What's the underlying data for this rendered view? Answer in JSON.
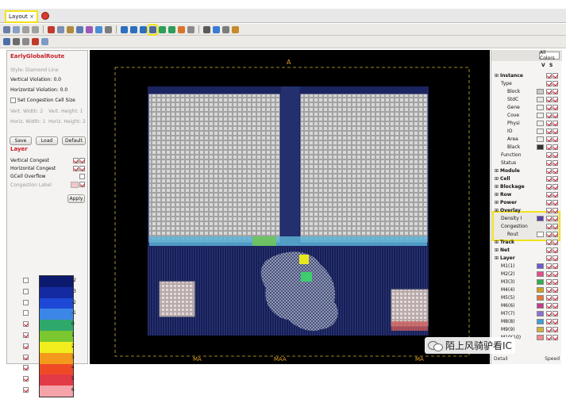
{
  "tab": {
    "label": "Layout",
    "close": "×"
  },
  "left_panel": {
    "title": "EarlyGlobalRoute",
    "style_label": "Style:",
    "style_opt1": "Diamond",
    "style_opt2": "Line",
    "vert_violation": "Vertical Violation: 0.0",
    "horiz_violation": "Horizontal Violation: 0.0",
    "set_congestion": "Set Congestion Cell Size",
    "vert_width": "Vert. Width: 2",
    "vert_height": "Vert. Height: 1",
    "horiz_width": "Horiz. Width: 1",
    "horiz_height": "Horiz. Height: 2",
    "save_label": "Save",
    "load_label": "Load",
    "default_label": "Default",
    "layer_section": "Layer",
    "layer_rows": [
      {
        "label": "Vertical Congest"
      },
      {
        "label": "Horizontal Congest"
      },
      {
        "label": "GCell Overflow"
      },
      {
        "label": "Congestion Label"
      }
    ],
    "apply_label": "Apply",
    "legend": [
      {
        "label": "-2",
        "color": "#0b1a6e",
        "checked": false
      },
      {
        "label": "-3",
        "color": "#142aa0",
        "checked": false
      },
      {
        "label": "-2",
        "color": "#1d48d6",
        "checked": false
      },
      {
        "label": "-1",
        "color": "#3b86e6",
        "checked": false
      },
      {
        "label": "0",
        "color": "#2fa86b",
        "checked": true
      },
      {
        "label": "1",
        "color": "#7ac72f",
        "checked": true
      },
      {
        "label": "2",
        "color": "#f2ee1d",
        "checked": true
      },
      {
        "label": "3",
        "color": "#f39a1c",
        "checked": true
      },
      {
        "label": "4",
        "color": "#ef4a25",
        "checked": true
      },
      {
        "label": "5",
        "color": "#e23a46",
        "checked": true
      },
      {
        "label": "6",
        "color": "#f4a3a8",
        "checked": true
      }
    ]
  },
  "right_panel": {
    "all_colors": "All Colors",
    "vs_v": "V",
    "vs_s": "S",
    "tree": [
      {
        "label": "Instance",
        "level": 0,
        "bold": true
      },
      {
        "label": "Type",
        "level": 1
      },
      {
        "label": "Block",
        "level": 2,
        "swatch": "#c9c9c9"
      },
      {
        "label": "StdC",
        "level": 2,
        "swatch": "#e8e8e8"
      },
      {
        "label": "Gene",
        "level": 2,
        "swatch": "#f0f0f0"
      },
      {
        "label": "Cove",
        "level": 2,
        "swatch": "#f0f0f0"
      },
      {
        "label": "Physi",
        "level": 2,
        "swatch": "#f0f0f0"
      },
      {
        "label": "IO",
        "level": 2,
        "swatch": "#f0f0f0"
      },
      {
        "label": "Area",
        "level": 2,
        "swatch": "#f0f0f0"
      },
      {
        "label": "Black",
        "level": 2,
        "swatch": "#333333"
      },
      {
        "label": "Function",
        "level": 1
      },
      {
        "label": "Status",
        "level": 1
      },
      {
        "label": "Module",
        "level": 0,
        "bold": true
      },
      {
        "label": "Cell",
        "level": 0,
        "bold": true
      },
      {
        "label": "Blockage",
        "level": 0,
        "bold": true
      },
      {
        "label": "Row",
        "level": 0,
        "bold": true
      },
      {
        "label": "Power",
        "level": 0,
        "bold": true
      },
      {
        "label": "Overlay",
        "level": 0,
        "bold": true
      },
      {
        "label": "Density I",
        "level": 1,
        "swatch": "#5b3fa8"
      },
      {
        "label": "Congestion",
        "level": 1
      },
      {
        "label": "Rout",
        "level": 2,
        "swatch": "#ffffff"
      },
      {
        "label": "Track",
        "level": 0,
        "bold": true
      },
      {
        "label": "Net",
        "level": 0,
        "bold": true
      },
      {
        "label": "Layer",
        "level": 0,
        "bold": true
      },
      {
        "label": "M1(1)",
        "level": 1,
        "swatch": "#6a5acd"
      },
      {
        "label": "M2(2)",
        "level": 1,
        "swatch": "#e84b8a"
      },
      {
        "label": "M3(3)",
        "level": 1,
        "swatch": "#2fb04f"
      },
      {
        "label": "M4(4)",
        "level": 1,
        "swatch": "#d4a017"
      },
      {
        "label": "M5(5)",
        "level": 1,
        "swatch": "#e8743b"
      },
      {
        "label": "M6(6)",
        "level": 1,
        "swatch": "#c23b8e"
      },
      {
        "label": "M7(7)",
        "level": 1,
        "swatch": "#8a6fd1"
      },
      {
        "label": "M8(8)",
        "level": 1,
        "swatch": "#3c9fd6"
      },
      {
        "label": "M9(9)",
        "level": 1,
        "swatch": "#d6b03c"
      },
      {
        "label": "M10(10)",
        "level": 1,
        "swatch": "#f08a8a"
      }
    ],
    "footer_left": "Detail",
    "footer_right": "Speed"
  },
  "canvas": {
    "top_marker": "A",
    "bottom_labels": [
      "MA",
      "MAA",
      "MA"
    ]
  },
  "watermark": {
    "text": "陌上风骑驴看IC"
  }
}
